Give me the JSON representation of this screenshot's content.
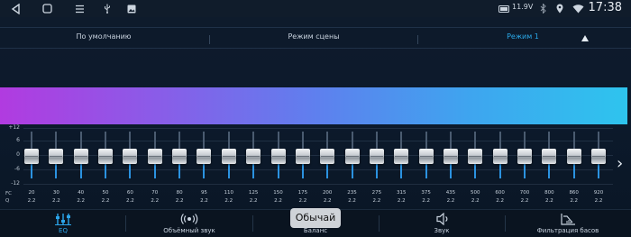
{
  "status_bar": {
    "nav_icons": [
      "back-icon",
      "home-icon",
      "menu-icon",
      "usb-icon",
      "image-icon"
    ],
    "voltage": "11.9V",
    "right_icons": [
      "battery-icon",
      "bluetooth-icon",
      "location-icon",
      "wifi-icon"
    ],
    "time": "17:38"
  },
  "mode_bar": {
    "items": [
      {
        "label": "По умолчанию",
        "active": false
      },
      {
        "label": "Режим сцены",
        "active": false
      },
      {
        "label": "Режим 1",
        "active": true
      }
    ],
    "accent_color": "#2aa8e8"
  },
  "equalizer": {
    "scale": [
      "+12",
      "6",
      "0",
      "-6",
      "-12"
    ],
    "fc_label": "FC",
    "q_label": "Q",
    "bands": [
      {
        "fc": "20",
        "q": "2.2",
        "gain": 0
      },
      {
        "fc": "30",
        "q": "2.2",
        "gain": 0
      },
      {
        "fc": "40",
        "q": "2.2",
        "gain": 0
      },
      {
        "fc": "50",
        "q": "2.2",
        "gain": 0
      },
      {
        "fc": "60",
        "q": "2.2",
        "gain": 0
      },
      {
        "fc": "70",
        "q": "2.2",
        "gain": 0
      },
      {
        "fc": "80",
        "q": "2.2",
        "gain": 0
      },
      {
        "fc": "95",
        "q": "2.2",
        "gain": 0
      },
      {
        "fc": "110",
        "q": "2.2",
        "gain": 0
      },
      {
        "fc": "125",
        "q": "2.2",
        "gain": 0
      },
      {
        "fc": "150",
        "q": "2.2",
        "gain": 0
      },
      {
        "fc": "175",
        "q": "2.2",
        "gain": 0
      },
      {
        "fc": "200",
        "q": "2.2",
        "gain": 0
      },
      {
        "fc": "235",
        "q": "2.2",
        "gain": 0
      },
      {
        "fc": "275",
        "q": "2.2",
        "gain": 0
      },
      {
        "fc": "315",
        "q": "2.2",
        "gain": 0
      },
      {
        "fc": "375",
        "q": "2.2",
        "gain": 0
      },
      {
        "fc": "435",
        "q": "2.2",
        "gain": 0
      },
      {
        "fc": "500",
        "q": "2.2",
        "gain": 0
      },
      {
        "fc": "600",
        "q": "2.2",
        "gain": 0
      },
      {
        "fc": "700",
        "q": "2.2",
        "gain": 0
      },
      {
        "fc": "800",
        "q": "2.2",
        "gain": 0
      },
      {
        "fc": "860",
        "q": "2.2",
        "gain": 0
      },
      {
        "fc": "920",
        "q": "2.2",
        "gain": 0
      }
    ],
    "next_icon": "chevron-right-icon",
    "band_gradient": [
      "#b13be0",
      "#5f7fee",
      "#2ec4ee"
    ]
  },
  "tabs": [
    {
      "label": "EQ",
      "icon": "equalizer-icon",
      "active": true
    },
    {
      "label": "Объёмный звук",
      "icon": "surround-icon",
      "active": false
    },
    {
      "label": "Баланс",
      "icon": "balance-icon",
      "active": false
    },
    {
      "label": "Звук",
      "icon": "speaker-icon",
      "active": false
    },
    {
      "label": "Фильтрация басов",
      "icon": "bass-filter-icon",
      "active": false
    }
  ],
  "toast": "Обычай"
}
